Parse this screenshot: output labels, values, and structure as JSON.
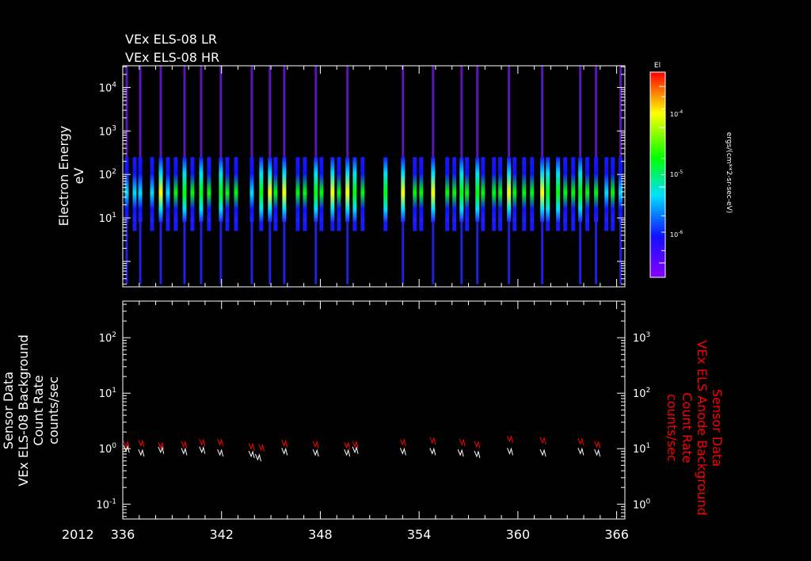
{
  "chart_data": [
    {
      "type": "heatmap",
      "title_lines": [
        "VEx ELS-08 LR",
        "VEx ELS-08 HR"
      ],
      "ylabel": [
        "Electron Energy",
        "eV"
      ],
      "yscale": "log",
      "ylim": [
        0.26,
        31600
      ],
      "yticks": [
        {
          "v": 10,
          "label": "10",
          "exp": "1"
        },
        {
          "v": 100,
          "label": "10",
          "exp": "2"
        },
        {
          "v": 1000,
          "label": "10",
          "exp": "3"
        },
        {
          "v": 10000,
          "label": "10",
          "exp": "4"
        }
      ],
      "xlim": [
        336,
        366.5
      ],
      "colorbar": {
        "title": "El",
        "label": "ergs/(cm**2-sr-sec-eV)",
        "ticks": [
          {
            "label": "10",
            "exp": "-4"
          },
          {
            "label": "10",
            "exp": "-5"
          },
          {
            "label": "10",
            "exp": "-6"
          }
        ]
      },
      "bursts": [
        {
          "day": 336.24,
          "full": true,
          "level": 0.5
        },
        {
          "day": 336.72,
          "full": false,
          "level": 0.4
        },
        {
          "day": 337.06,
          "full": true,
          "level": 0.5
        },
        {
          "day": 337.78,
          "full": false,
          "level": 0.5
        },
        {
          "day": 338.31,
          "full": true,
          "level": 0.8
        },
        {
          "day": 338.74,
          "full": false,
          "level": 0.5
        },
        {
          "day": 339.22,
          "full": false,
          "level": 0.6
        },
        {
          "day": 339.75,
          "full": true,
          "level": 0.7
        },
        {
          "day": 340.23,
          "full": false,
          "level": 0.6
        },
        {
          "day": 340.76,
          "full": true,
          "level": 0.7
        },
        {
          "day": 341.24,
          "full": false,
          "level": 0.6
        },
        {
          "day": 341.96,
          "full": true,
          "level": 0.7
        },
        {
          "day": 342.35,
          "full": false,
          "level": 0.6
        },
        {
          "day": 342.88,
          "full": false,
          "level": 0.6
        },
        {
          "day": 343.84,
          "full": true,
          "level": 0.5
        },
        {
          "day": 344.41,
          "full": false,
          "level": 0.7
        },
        {
          "day": 344.94,
          "full": true,
          "level": 0.8
        },
        {
          "day": 345.28,
          "full": false,
          "level": 0.6
        },
        {
          "day": 345.81,
          "full": true,
          "level": 0.9
        },
        {
          "day": 346.63,
          "full": false,
          "level": 0.6
        },
        {
          "day": 347.06,
          "full": false,
          "level": 0.6
        },
        {
          "day": 347.73,
          "full": true,
          "level": 0.7
        },
        {
          "day": 348.07,
          "full": false,
          "level": 0.6
        },
        {
          "day": 348.74,
          "full": false,
          "level": 0.8
        },
        {
          "day": 349.13,
          "full": false,
          "level": 0.6
        },
        {
          "day": 349.65,
          "full": true,
          "level": 0.8
        },
        {
          "day": 350.09,
          "full": false,
          "level": 0.7
        },
        {
          "day": 350.57,
          "full": false,
          "level": 0.6
        },
        {
          "day": 351.96,
          "full": false,
          "level": 0.7
        },
        {
          "day": 353.02,
          "full": true,
          "level": 0.9
        },
        {
          "day": 353.74,
          "full": false,
          "level": 0.6
        },
        {
          "day": 354.13,
          "full": false,
          "level": 0.6
        },
        {
          "day": 354.85,
          "full": true,
          "level": 0.8
        },
        {
          "day": 355.71,
          "full": false,
          "level": 0.6
        },
        {
          "day": 356.14,
          "full": false,
          "level": 0.6
        },
        {
          "day": 356.58,
          "full": true,
          "level": 0.7
        },
        {
          "day": 356.91,
          "full": false,
          "level": 0.6
        },
        {
          "day": 357.54,
          "full": true,
          "level": 0.7
        },
        {
          "day": 357.88,
          "full": false,
          "level": 0.6
        },
        {
          "day": 358.55,
          "full": false,
          "level": 0.6
        },
        {
          "day": 358.93,
          "full": false,
          "level": 0.6
        },
        {
          "day": 359.46,
          "full": true,
          "level": 0.8
        },
        {
          "day": 359.8,
          "full": false,
          "level": 0.6
        },
        {
          "day": 360.38,
          "full": false,
          "level": 0.6
        },
        {
          "day": 360.86,
          "full": false,
          "level": 0.6
        },
        {
          "day": 361.48,
          "full": true,
          "level": 0.8
        },
        {
          "day": 361.82,
          "full": false,
          "level": 0.7
        },
        {
          "day": 362.44,
          "full": false,
          "level": 0.7
        },
        {
          "day": 362.88,
          "full": false,
          "level": 0.6
        },
        {
          "day": 363.36,
          "full": false,
          "level": 0.6
        },
        {
          "day": 363.79,
          "full": true,
          "level": 0.7
        },
        {
          "day": 364.22,
          "full": false,
          "level": 0.6
        },
        {
          "day": 364.75,
          "full": true,
          "level": 0.6
        },
        {
          "day": 365.38,
          "full": false,
          "level": 0.5
        },
        {
          "day": 365.76,
          "full": false,
          "level": 0.6
        },
        {
          "day": 366.24,
          "full": true,
          "level": 0.5
        }
      ]
    },
    {
      "type": "line",
      "ylabel_left": [
        "Sensor Data",
        "VEx ELS-08 Background",
        "Count Rate",
        "counts/sec"
      ],
      "ylabel_right": [
        "Sensor Data",
        "VEx ELS Anode Background",
        "Count Rate",
        "counts/sec"
      ],
      "yscale": "log",
      "ylim": [
        0.054,
        457
      ],
      "yticks": [
        {
          "v": 0.1,
          "label": "10",
          "exp": "-1"
        },
        {
          "v": 1,
          "label": "10",
          "exp": "0"
        },
        {
          "v": 10,
          "label": "10",
          "exp": "1"
        },
        {
          "v": 100,
          "label": "10",
          "exp": "2"
        }
      ],
      "yticks_right": [
        {
          "v": 1,
          "label": "10",
          "exp": "0"
        },
        {
          "v": 10,
          "label": "10",
          "exp": "1"
        },
        {
          "v": 100,
          "label": "10",
          "exp": "2"
        },
        {
          "v": 1000,
          "label": "10",
          "exp": "3"
        }
      ],
      "xlim": [
        336,
        366.5
      ],
      "xyear": "2012",
      "xticks": [
        "336",
        "342",
        "348",
        "354",
        "360",
        "366"
      ],
      "series": [
        {
          "name": "ELS-08 Background",
          "color": "#ffffff",
          "points": [
            [
              336.2,
              1.0
            ],
            [
              337.1,
              0.85
            ],
            [
              338.3,
              0.95
            ],
            [
              339.7,
              0.9
            ],
            [
              340.8,
              0.95
            ],
            [
              341.9,
              0.85
            ],
            [
              343.8,
              0.8
            ],
            [
              344.2,
              0.7
            ],
            [
              345.8,
              0.9
            ],
            [
              347.7,
              0.85
            ],
            [
              349.6,
              0.85
            ],
            [
              350.1,
              0.95
            ],
            [
              353.0,
              0.9
            ],
            [
              354.8,
              0.9
            ],
            [
              356.5,
              0.85
            ],
            [
              357.5,
              0.8
            ],
            [
              359.5,
              0.9
            ],
            [
              361.5,
              0.85
            ],
            [
              363.8,
              0.9
            ],
            [
              364.8,
              0.85
            ]
          ]
        },
        {
          "name": "ELS Anode Background",
          "color": "#ff0000",
          "points": [
            [
              336.2,
              1.2
            ],
            [
              337.1,
              1.25
            ],
            [
              338.3,
              1.15
            ],
            [
              339.7,
              1.2
            ],
            [
              340.8,
              1.3
            ],
            [
              341.9,
              1.3
            ],
            [
              343.8,
              1.1
            ],
            [
              344.4,
              1.05
            ],
            [
              345.8,
              1.25
            ],
            [
              347.7,
              1.2
            ],
            [
              349.6,
              1.15
            ],
            [
              350.1,
              1.2
            ],
            [
              353.0,
              1.3
            ],
            [
              354.8,
              1.4
            ],
            [
              356.6,
              1.3
            ],
            [
              357.5,
              1.2
            ],
            [
              359.5,
              1.5
            ],
            [
              361.5,
              1.4
            ],
            [
              363.8,
              1.35
            ],
            [
              364.8,
              1.2
            ]
          ]
        }
      ]
    }
  ]
}
